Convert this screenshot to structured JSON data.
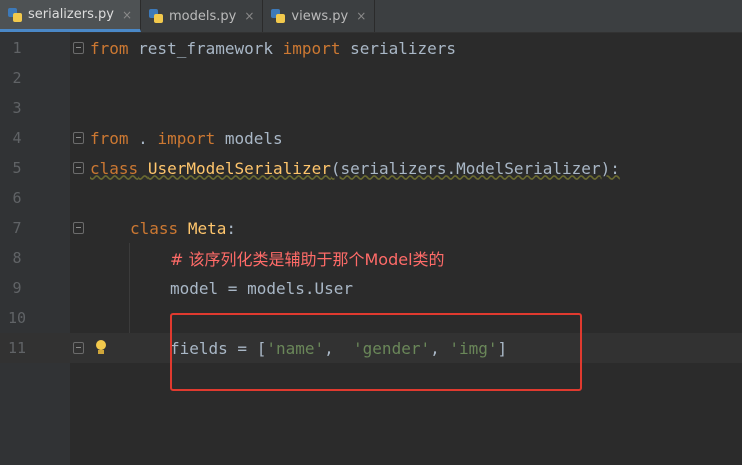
{
  "tabs": [
    {
      "name": "serializers.py",
      "active": true
    },
    {
      "name": "models.py",
      "active": false
    },
    {
      "name": "views.py",
      "active": false
    }
  ],
  "close_glyph": "×",
  "lines": [
    {
      "num": "1"
    },
    {
      "num": "2"
    },
    {
      "num": "3"
    },
    {
      "num": "4"
    },
    {
      "num": "5"
    },
    {
      "num": "6"
    },
    {
      "num": "7"
    },
    {
      "num": "8"
    },
    {
      "num": "9"
    },
    {
      "num": "10"
    },
    {
      "num": "11"
    }
  ],
  "code": {
    "l1_kw1": "from",
    "l1_mod": " rest_framework ",
    "l1_kw2": "import",
    "l1_name": " serializers",
    "l4_kw1": "from",
    "l4_dot": " . ",
    "l4_kw2": "import",
    "l4_name": " models",
    "l5_kw": "class",
    "l5_cls": "UserModelSerializer",
    "l5_paren_open": "(",
    "l5_base": "serializers.ModelSerializer",
    "l5_paren_close": "):",
    "l7_kw": "class",
    "l7_cls": "Meta",
    "l7_colon": ":",
    "l8_comment": "# 该序列化类是辅助于那个Model类的",
    "l9_text": "model = models.User",
    "l11_pre": "fields = [",
    "l11_s1": "'name'",
    "l11_sep1": ",  ",
    "l11_s2": "'gender'",
    "l11_sep2": ", ",
    "l11_s3": "'img'",
    "l11_post": "]"
  },
  "colors": {
    "keyword": "#cc7832",
    "class_name": "#ffc66d",
    "comment": "#ff6b68",
    "string": "#6a8759",
    "highlight_box": "#e03a2f"
  }
}
